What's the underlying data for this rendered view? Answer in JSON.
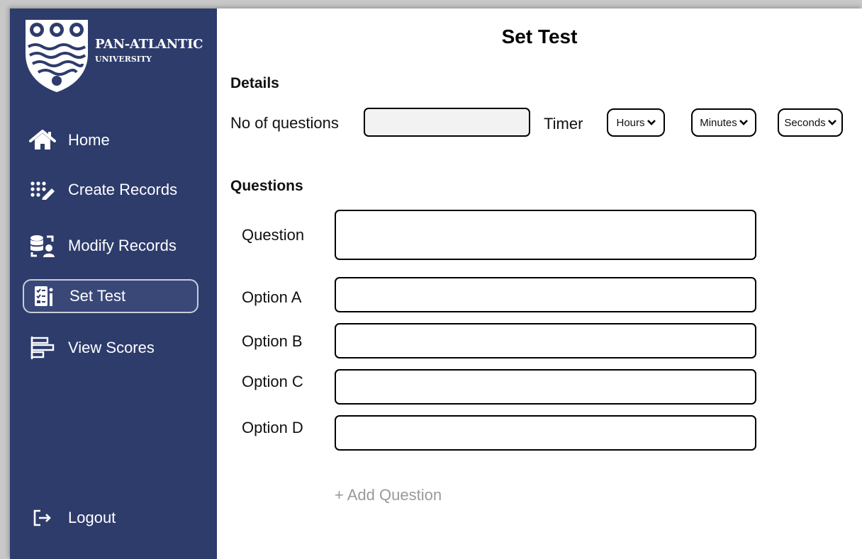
{
  "sidebar": {
    "logo": {
      "name": "PAN-ATLANTIC",
      "sub": "UNIVERSITY"
    },
    "items": [
      {
        "label": "Home",
        "icon": "home-icon"
      },
      {
        "label": "Create Records",
        "icon": "keypad-edit-icon"
      },
      {
        "label": "Modify Records",
        "icon": "database-user-icon"
      },
      {
        "label": "Set Test",
        "icon": "checklist-icon",
        "active": true
      },
      {
        "label": "View Scores",
        "icon": "bar-chart-icon"
      }
    ],
    "logout": {
      "label": "Logout",
      "icon": "logout-icon"
    }
  },
  "page": {
    "title": "Set Test"
  },
  "details": {
    "heading": "Details",
    "num_questions_label": "No of questions",
    "num_questions_value": "",
    "timer_label": "Timer",
    "hours_label": "Hours",
    "minutes_label": "Minutes",
    "seconds_label": "Seconds"
  },
  "questions": {
    "heading": "Questions",
    "question_label": "Question",
    "option_a_label": "Option A",
    "option_b_label": "Option B",
    "option_c_label": "Option C",
    "option_d_label": "Option D",
    "add_label": "+ Add Question"
  },
  "colors": {
    "sidebar": "#2e3c6c",
    "active_border": "#c9cdd8",
    "muted_text": "#9a9a9a"
  }
}
